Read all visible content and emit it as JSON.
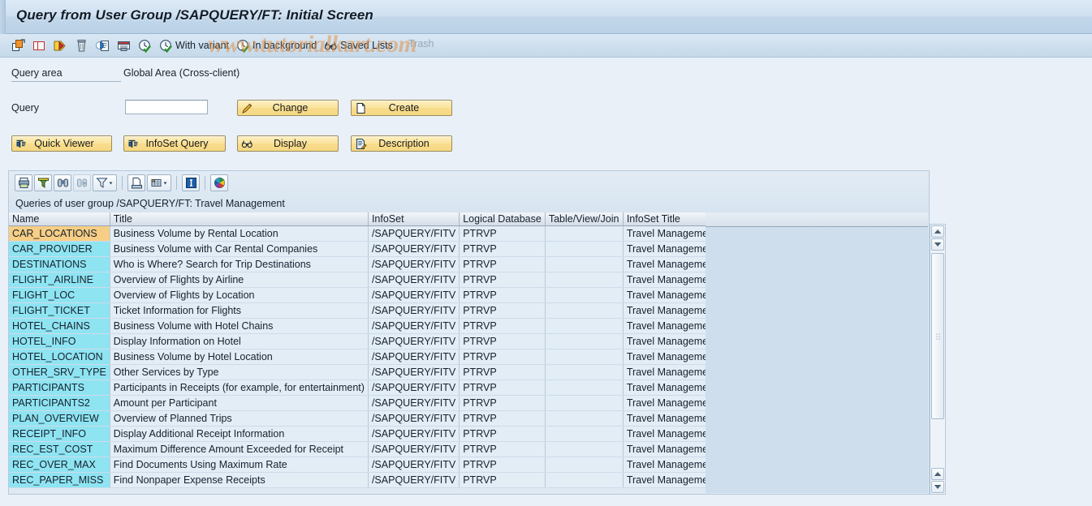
{
  "window": {
    "title": "Query from User Group /SAPQUERY/FT: Initial Screen"
  },
  "watermark": {
    "text": "www.tutorialkart.com",
    "overlay_label": "Trash"
  },
  "app_toolbar": {
    "buttons": [
      {
        "name": "create-icon",
        "icon": "create",
        "label": ""
      },
      {
        "name": "copy-icon",
        "icon": "copy",
        "label": ""
      },
      {
        "name": "rename-icon",
        "icon": "rename",
        "label": ""
      },
      {
        "name": "delete-icon",
        "icon": "trash",
        "label": ""
      },
      {
        "name": "compare-icon",
        "icon": "compare",
        "label": ""
      },
      {
        "name": "convert-icon",
        "icon": "convert",
        "label": ""
      },
      {
        "name": "execute-icon",
        "icon": "clock-check",
        "label": ""
      },
      {
        "name": "with-variant-button",
        "icon": "clock-check",
        "label": "With variant"
      },
      {
        "name": "in-background-button",
        "icon": "clock-check",
        "label": "In background"
      },
      {
        "name": "saved-lists-button",
        "icon": "glasses",
        "label": "Saved Lists"
      }
    ]
  },
  "form": {
    "query_area_label": "Query area",
    "query_area_value": "Global Area (Cross-client)",
    "query_label": "Query",
    "query_value": "",
    "query_placeholder": "",
    "buttons": {
      "change": "Change",
      "create": "Create",
      "quick_viewer": "Quick Viewer",
      "infoset_query": "InfoSet Query",
      "display": "Display",
      "description": "Description"
    }
  },
  "grid_toolbar": {
    "buttons": [
      {
        "name": "print-button",
        "icon": "printer"
      },
      {
        "name": "sort-filter-button",
        "icon": "funnel-solid"
      },
      {
        "name": "find-button",
        "icon": "binoculars"
      },
      {
        "name": "find-next-button",
        "icon": "binoculars-plus",
        "disabled": true
      },
      {
        "name": "filter-button",
        "icon": "funnel",
        "menu": true
      },
      {
        "name": "print-preview-button",
        "icon": "print-preview"
      },
      {
        "name": "spreadsheet-button",
        "icon": "spreadsheet",
        "menu": true
      },
      {
        "name": "info-button",
        "icon": "info"
      },
      {
        "name": "color-settings-button",
        "icon": "palette"
      }
    ]
  },
  "table": {
    "caption": "Queries of user group /SAPQUERY/FT: Travel Management",
    "columns": [
      "Name",
      "Title",
      "InfoSet",
      "Logical Database",
      "Table/View/Join",
      "InfoSet Title"
    ],
    "selected_row_index": 0,
    "rows": [
      [
        "CAR_LOCATIONS",
        "Business Volume by Rental Location",
        "/SAPQUERY/FITV",
        "PTRVP",
        "",
        "Travel Management"
      ],
      [
        "CAR_PROVIDER",
        "Business Volume with Car Rental Companies",
        "/SAPQUERY/FITV",
        "PTRVP",
        "",
        "Travel Management"
      ],
      [
        "DESTINATIONS",
        "Who is Where? Search for Trip Destinations",
        "/SAPQUERY/FITV",
        "PTRVP",
        "",
        "Travel Management"
      ],
      [
        "FLIGHT_AIRLINE",
        "Overview of Flights by Airline",
        "/SAPQUERY/FITV",
        "PTRVP",
        "",
        "Travel Management"
      ],
      [
        "FLIGHT_LOC",
        "Overview of Flights by Location",
        "/SAPQUERY/FITV",
        "PTRVP",
        "",
        "Travel Management"
      ],
      [
        "FLIGHT_TICKET",
        "Ticket Information for Flights",
        "/SAPQUERY/FITV",
        "PTRVP",
        "",
        "Travel Management"
      ],
      [
        "HOTEL_CHAINS",
        "Business Volume with Hotel Chains",
        "/SAPQUERY/FITV",
        "PTRVP",
        "",
        "Travel Management"
      ],
      [
        "HOTEL_INFO",
        "Display Information on Hotel",
        "/SAPQUERY/FITV",
        "PTRVP",
        "",
        "Travel Management"
      ],
      [
        "HOTEL_LOCATION",
        "Business Volume by Hotel Location",
        "/SAPQUERY/FITV",
        "PTRVP",
        "",
        "Travel Management"
      ],
      [
        "OTHER_SRV_TYPE",
        "Other Services by Type",
        "/SAPQUERY/FITV",
        "PTRVP",
        "",
        "Travel Management"
      ],
      [
        "PARTICIPANTS",
        "Participants in Receipts (for example, for entertainment)",
        "/SAPQUERY/FITV",
        "PTRVP",
        "",
        "Travel Management"
      ],
      [
        "PARTICIPANTS2",
        "Amount per Participant",
        "/SAPQUERY/FITV",
        "PTRVP",
        "",
        "Travel Management"
      ],
      [
        "PLAN_OVERVIEW",
        "Overview of Planned Trips",
        "/SAPQUERY/FITV",
        "PTRVP",
        "",
        "Travel Management"
      ],
      [
        "RECEIPT_INFO",
        "Display Additional Receipt Information",
        "/SAPQUERY/FITV",
        "PTRVP",
        "",
        "Travel Management"
      ],
      [
        "REC_EST_COST",
        "Maximum Difference Amount Exceeded for Receipt",
        "/SAPQUERY/FITV",
        "PTRVP",
        "",
        "Travel Management"
      ],
      [
        "REC_OVER_MAX",
        "Find Documents Using Maximum Rate",
        "/SAPQUERY/FITV",
        "PTRVP",
        "",
        "Travel Management"
      ],
      [
        "REC_PAPER_MISS",
        "Find Nonpaper Expense Receipts",
        "/SAPQUERY/FITV",
        "PTRVP",
        "",
        "Travel Management"
      ]
    ]
  },
  "colors": {
    "title_bar": "#c2d7ea",
    "canvas": "#eaf0f7",
    "button_yellow": "#f8dd8e",
    "row_name_cyan": "#8fe4f2",
    "row_selected_gold": "#f7ce85",
    "cell_bg": "#e2edf6",
    "watermark_orange": "#e09046"
  }
}
